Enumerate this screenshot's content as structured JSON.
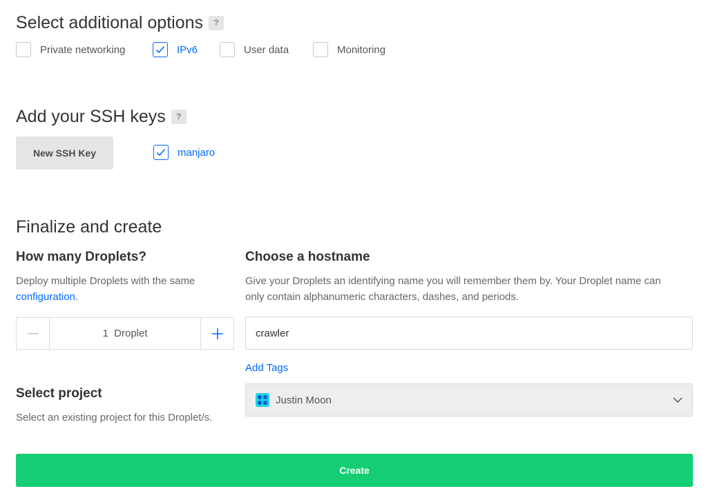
{
  "options": {
    "title": "Select additional options",
    "help": "?",
    "items": [
      {
        "label": "Private networking",
        "checked": false
      },
      {
        "label": "IPv6",
        "checked": true
      },
      {
        "label": "User data",
        "checked": false
      },
      {
        "label": "Monitoring",
        "checked": false
      }
    ]
  },
  "ssh": {
    "title": "Add your SSH keys",
    "help": "?",
    "new_key_label": "New SSH Key",
    "keys": [
      {
        "label": "manjaro",
        "checked": true
      }
    ]
  },
  "finalize": {
    "title": "Finalize and create",
    "droplets": {
      "heading": "How many Droplets?",
      "desc_pre": "Deploy multiple Droplets with the same",
      "desc_link": "configuration",
      "desc_post": ".",
      "count": "1",
      "unit": "Droplet"
    },
    "hostname": {
      "heading": "Choose a hostname",
      "desc_line1": "Give your Droplets an identifying name you will remember them by. Your Droplet name can",
      "desc_line2": "only contain alphanumeric characters, dashes, and periods.",
      "value": "crawler",
      "add_tags": "Add Tags"
    },
    "project": {
      "heading": "Select project",
      "desc": "Select an existing project for this Droplet/s.",
      "selected": "Justin Moon"
    },
    "create_label": "Create"
  },
  "colors": {
    "accent": "#0069ff",
    "create": "#15cd72"
  }
}
